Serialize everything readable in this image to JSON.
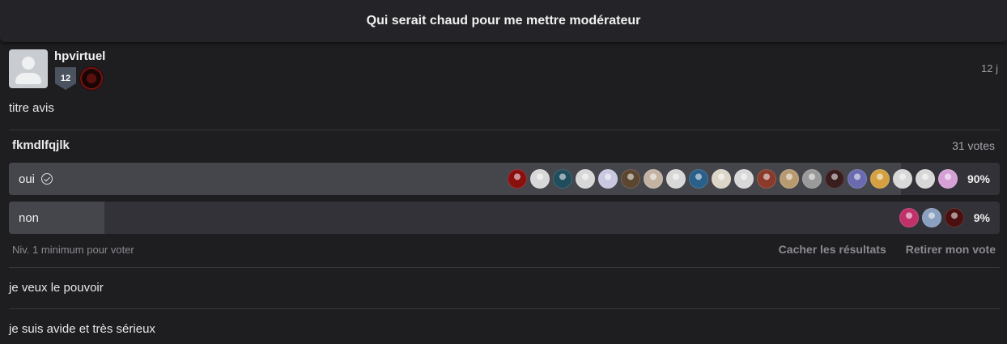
{
  "header": {
    "title": "Qui serait chaud pour me mettre modérateur"
  },
  "post": {
    "author": "hpvirtuel",
    "level": "12",
    "date": "12 j",
    "text": "titre avis"
  },
  "poll": {
    "title": "fkmdlfqjlk",
    "votes_label": "31 votes",
    "options": [
      {
        "label": "oui",
        "percent_label": "90%",
        "share": 0.9,
        "selected": true,
        "voter_icons": [
          "user-avatar-icon",
          "user-avatar-icon",
          "user-avatar-icon",
          "user-avatar-icon",
          "user-avatar-icon",
          "user-avatar-icon",
          "user-avatar-icon",
          "user-avatar-icon",
          "user-avatar-icon",
          "user-avatar-icon",
          "user-avatar-icon",
          "user-avatar-icon",
          "user-avatar-icon",
          "user-avatar-icon",
          "user-avatar-icon",
          "user-avatar-icon",
          "user-avatar-icon",
          "user-avatar-icon",
          "user-avatar-icon",
          "user-avatar-icon"
        ],
        "voter_colors": [
          "#8a1010",
          "#d8d8d8",
          "#1f4d5c",
          "#d8d8d8",
          "#c8c8e0",
          "#5c4630",
          "#c4b3a3",
          "#d8d8d8",
          "#2a5f8a",
          "#dcd6c8",
          "#d8d8d8",
          "#8a3a2a",
          "#b89a70",
          "#9a9a9a",
          "#3a1e1e",
          "#6a6ab0",
          "#d4a040",
          "#d8d8d8",
          "#d8d8d8",
          "#d6a0d6"
        ]
      },
      {
        "label": "non",
        "percent_label": "9%",
        "share": 0.096,
        "selected": false,
        "voter_icons": [
          "user-avatar-icon",
          "user-avatar-icon",
          "user-avatar-icon"
        ],
        "voter_colors": [
          "#c0306a",
          "#8aa0c0",
          "#4a1010"
        ]
      }
    ],
    "min_level_note": "Niv. 1 minimum pour voter",
    "hide_results_label": "Cacher les résultats",
    "remove_vote_label": "Retirer mon vote"
  },
  "comments": [
    {
      "text": "je veux le pouvoir"
    },
    {
      "text": "je suis avide et très sérieux"
    }
  ],
  "colors": {
    "background": "#1e1e21",
    "header_bg": "#242428",
    "option_bg": "#323238",
    "option_fill": "#45454c",
    "muted_text": "#8a8b90"
  }
}
